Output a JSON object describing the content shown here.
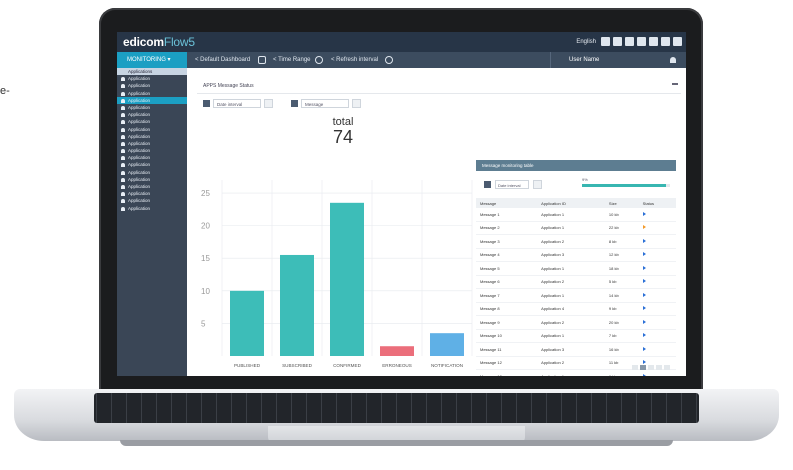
{
  "edge_text": "e-",
  "app": {
    "logo_main": "edicom",
    "logo_accent": "Flow5",
    "lang": "English",
    "toolbar_icons": [
      "grid-icon",
      "settings-icon",
      "info-icon",
      "help-icon",
      "window-icon",
      "list-icon",
      "menu-icon"
    ]
  },
  "navbar": {
    "selector": "MONITORING ▾",
    "items": [
      "< Default Dashboard",
      "< Time Range",
      "< Refresh interval"
    ],
    "user": "User Name"
  },
  "sidebar": {
    "header": "Applications",
    "items": [
      "Application",
      "Application",
      "Application",
      "Application",
      "Application",
      "Application",
      "Application",
      "Application",
      "Application",
      "Application",
      "Application",
      "Application",
      "Application",
      "Application",
      "Application",
      "Application",
      "Application",
      "Application",
      "Application"
    ],
    "active_index": 3
  },
  "panel": {
    "title": "APPS Message Status",
    "filter1": "Date interval",
    "filter2": "Message"
  },
  "total": {
    "label": "total",
    "value": "74"
  },
  "chart_data": {
    "type": "bar",
    "categories": [
      "PUBLISHED",
      "SUBSCRIBED",
      "CONFIRMED",
      "ERRONEOUS",
      "NOTIFICATION"
    ],
    "values": [
      10,
      15.5,
      23.5,
      1.5,
      3.5
    ],
    "colors": [
      "#3dbdb8",
      "#3dbdb8",
      "#3dbdb8",
      "#eb6e7b",
      "#5fb0e6"
    ],
    "yticks": [
      "5",
      "10",
      "15",
      "20",
      "25"
    ],
    "ylim": [
      0,
      27
    ],
    "grid": true
  },
  "table_panel": {
    "title": "Message monitoring table",
    "filter": "Date interval",
    "progress_label": "9%",
    "progress": 0.96,
    "columns": [
      "Message",
      "Application ID",
      "Size",
      "Status"
    ],
    "rows": [
      [
        "Message 1",
        "Application 1",
        "10 kb",
        "blue"
      ],
      [
        "Message 2",
        "Application 1",
        "22 kb",
        "orange"
      ],
      [
        "Message 3",
        "Application 2",
        "8 kb",
        "blue"
      ],
      [
        "Message 4",
        "Application 3",
        "12 kb",
        "blue"
      ],
      [
        "Message 5",
        "Application 1",
        "18 kb",
        "blue"
      ],
      [
        "Message 6",
        "Application 2",
        "5 kb",
        "blue"
      ],
      [
        "Message 7",
        "Application 1",
        "14 kb",
        "blue"
      ],
      [
        "Message 8",
        "Application 4",
        "9 kb",
        "blue"
      ],
      [
        "Message 9",
        "Application 2",
        "20 kb",
        "blue"
      ],
      [
        "Message 10",
        "Application 1",
        "7 kb",
        "blue"
      ],
      [
        "Message 11",
        "Application 3",
        "16 kb",
        "blue"
      ],
      [
        "Message 12",
        "Application 2",
        "11 kb",
        "blue"
      ],
      [
        "Message 13",
        "Application 1",
        "6 kb",
        "blue"
      ],
      [
        "Message 14",
        "Application 4",
        "13 kb",
        "blue"
      ]
    ]
  }
}
